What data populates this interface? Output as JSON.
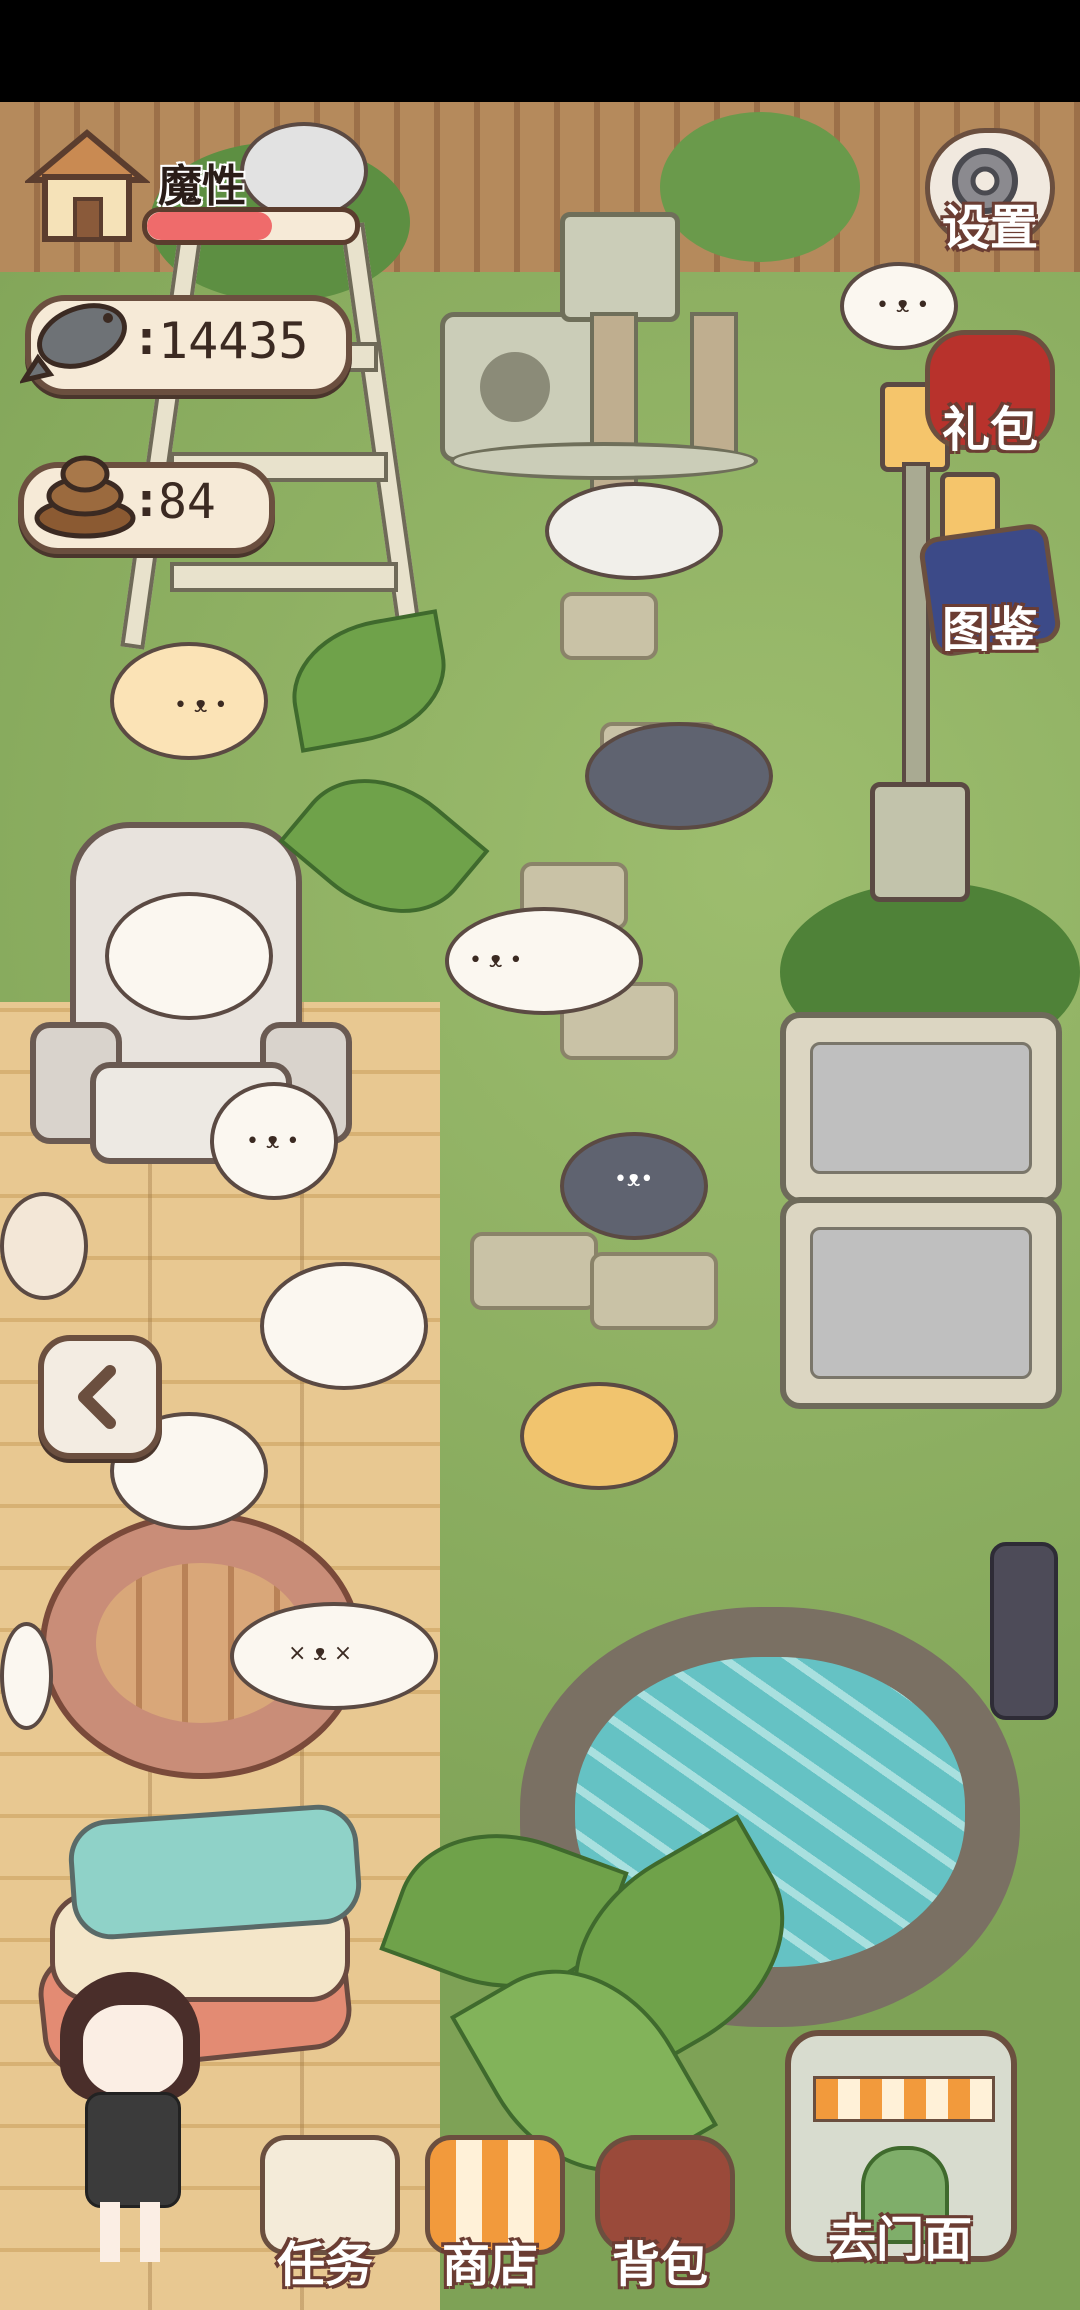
{
  "status": {
    "mood_label": "魔性",
    "mood_level": 0.6,
    "fish_count": "14435",
    "poop_count": "84",
    "count_prefix": ":"
  },
  "side_menu": {
    "settings": "设置",
    "gift": "礼包",
    "catalog": "图鉴"
  },
  "bottom_menu": {
    "tasks": "任务",
    "shop": "商店",
    "backpack": "背包",
    "storefront": "去门面"
  },
  "icons": {
    "home": "house-icon",
    "fish": "fish-icon",
    "poop": "poop-icon",
    "back": "back-arrow-icon"
  },
  "colors": {
    "ui_border": "#6b4f3f",
    "ui_fill": "#f6ead7",
    "mood_bar": "#ef6b6b",
    "grass": "#8fae66",
    "deck": "#e8c891"
  }
}
